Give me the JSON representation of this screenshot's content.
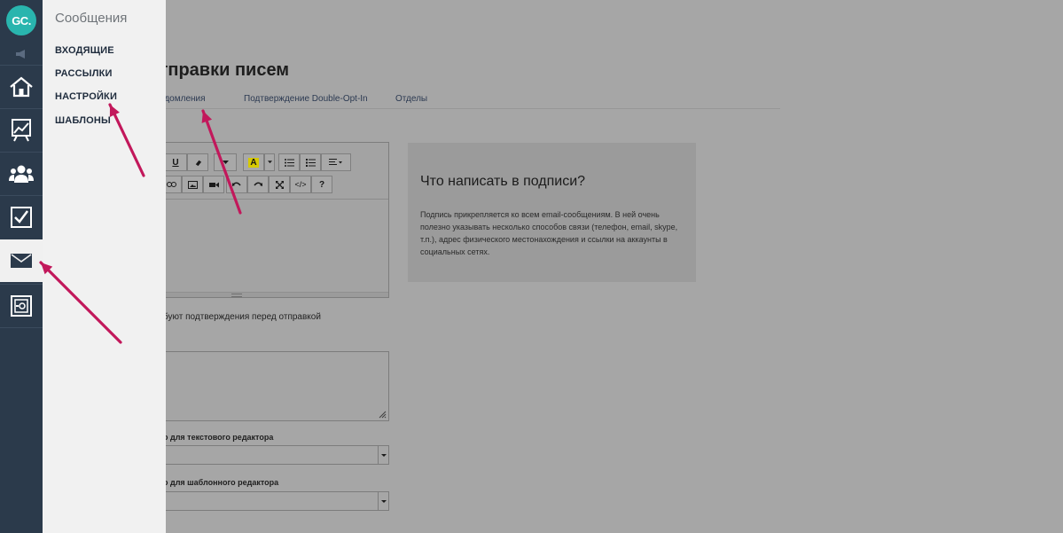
{
  "app": {
    "logo_text": "GC.",
    "accent_color": "#29b5ae",
    "sidebar_color": "#2b3a4b"
  },
  "page": {
    "title": "и отправки писем",
    "tabs": [
      {
        "label": "едомления"
      },
      {
        "label": "Подтверждение Double-Opt-In"
      },
      {
        "label": "Отделы"
      }
    ]
  },
  "editor": {
    "toolbar_icons": [
      "underline-icon",
      "eraser-icon",
      "font-color-icon",
      "bulleted-list-icon",
      "numbered-list-icon",
      "align-icon",
      "link-icon",
      "image-icon",
      "video-icon",
      "undo-icon",
      "redo-icon",
      "fullscreen-icon",
      "code-icon",
      "help-icon"
    ],
    "underline_label": "U",
    "font_color_label": "A",
    "code_label": "</>",
    "help_label": "?"
  },
  "form": {
    "checkbox_label": "буют подтверждения перед отправкой",
    "text_editor_label": "о для текстового редактора",
    "template_editor_label": "о для шаблонного редактора"
  },
  "hint": {
    "title": "Что написать в подписи?",
    "text": "Подпись прикрепляется ко всем email-сообщениям. В ней очень полезно указывать несколько способов связи (телефон, email, skype, т.п.), адрес физического местонахождения и ссылки на аккаунты в социальных сетях."
  },
  "flyout": {
    "title": "Сообщения",
    "items": [
      {
        "label": "ВХОДЯЩИЕ"
      },
      {
        "label": "РАССЫЛКИ"
      },
      {
        "label": "НАСТРОЙКИ"
      },
      {
        "label": "ШАБЛОНЫ"
      }
    ]
  },
  "annotation": {
    "arrow_color": "#c2185b"
  }
}
